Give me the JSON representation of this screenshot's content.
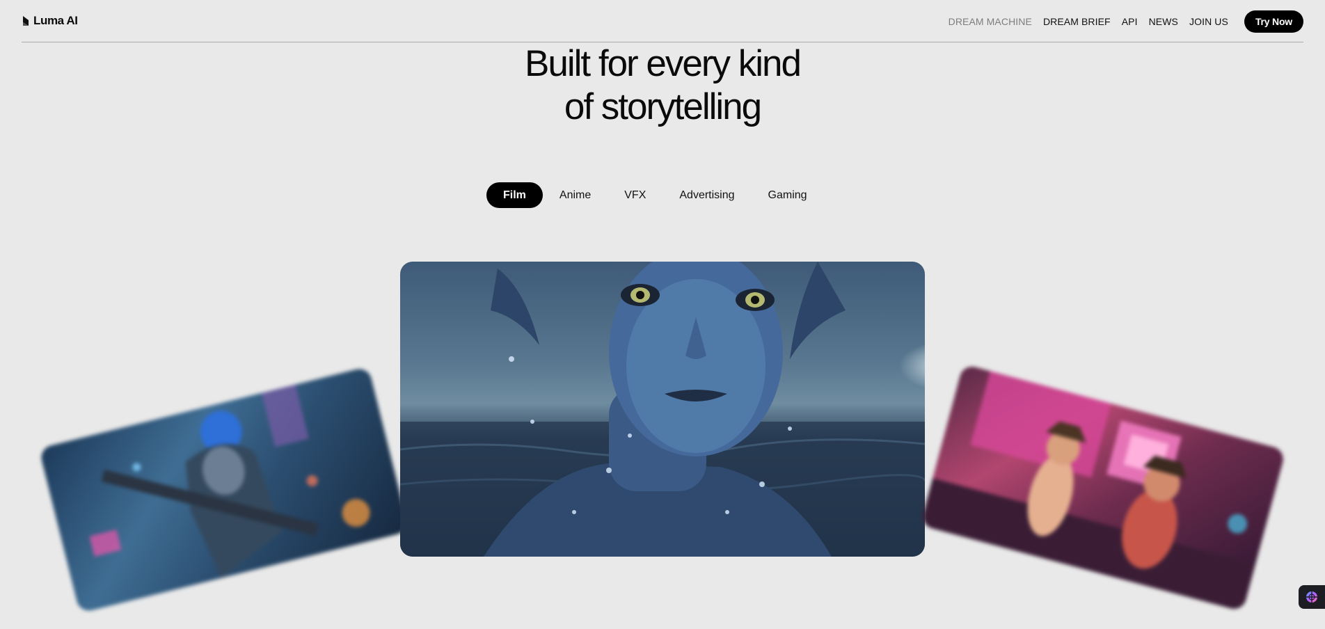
{
  "header": {
    "logo_text": "Luma AI",
    "nav": [
      {
        "label": "DREAM MACHINE",
        "muted": true
      },
      {
        "label": "DREAM BRIEF"
      },
      {
        "label": "API"
      },
      {
        "label": "NEWS"
      },
      {
        "label": "JOIN US"
      }
    ],
    "cta_label": "Try Now"
  },
  "hero": {
    "title_line1": "Built for every kind",
    "title_line2": "of storytelling"
  },
  "tabs": [
    {
      "label": "Film",
      "active": true
    },
    {
      "label": "Anime"
    },
    {
      "label": "VFX"
    },
    {
      "label": "Advertising"
    },
    {
      "label": "Gaming"
    }
  ],
  "gallery": {
    "main_icon": "sea-creature-portrait-image",
    "left_icon": "anime-warrior-image",
    "right_icon": "toy-characters-scene-image"
  },
  "widget_icon": "assistant-orb-icon",
  "colors": {
    "background": "#e9e9e9",
    "accent": "#000000",
    "muted_nav": "#7d7d7d"
  }
}
